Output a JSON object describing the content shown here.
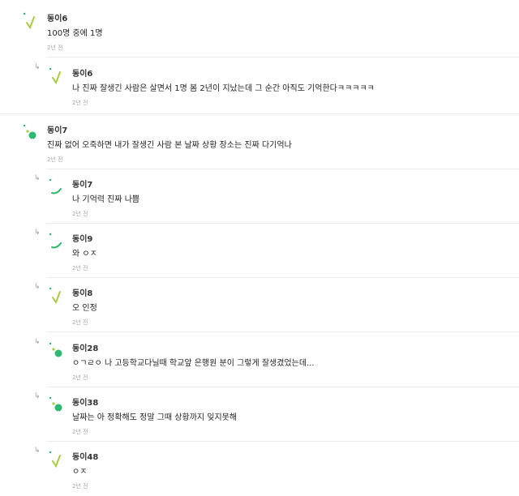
{
  "colors": {
    "accent_green": "#2eb872",
    "accent_lime": "#a5cf3a",
    "divider": "#ececec",
    "time_text": "#a8a8a8"
  },
  "comments": [
    {
      "nick": "동이6",
      "text": "100명 중에 1명",
      "time": "2년 전",
      "reply": false,
      "avatar_icon": "lime-slash-avatar-icon"
    },
    {
      "nick": "동이6",
      "text": "나 진짜 잘생긴 사람은 살면서 1명 봄 2년이 지났는데 그 순간 아직도 기억한다ㅋㅋㅋㅋㅋ",
      "time": "2년 전",
      "reply": true,
      "avatar_icon": "lime-slash-avatar-icon"
    },
    {
      "nick": "동이7",
      "text": "진짜 없어 오죽하면 내가 잘생긴 사람 본 날짜 상황 장소는 진짜 다기억나",
      "time": "2년 전",
      "reply": false,
      "avatar_icon": "green-dot-avatar-icon"
    },
    {
      "nick": "동이7",
      "text": "나 기억력 진짜 나쁨",
      "time": "2년 전",
      "reply": true,
      "avatar_icon": "green-arc-avatar-icon"
    },
    {
      "nick": "동이9",
      "text": "와 ㅇㅈ",
      "time": "2년 전",
      "reply": true,
      "avatar_icon": "green-arc-avatar-icon"
    },
    {
      "nick": "동이8",
      "text": "오 인정",
      "time": "2년 전",
      "reply": true,
      "avatar_icon": "lime-slash-avatar-icon"
    },
    {
      "nick": "동이28",
      "text": "ㅇㄱㄹㅇ 나 고등학교다닐때 학교앞 은행원 분이 그렇게 잘생겼었는데...",
      "time": "2년 전",
      "reply": true,
      "avatar_icon": "green-dot-avatar-icon"
    },
    {
      "nick": "동이38",
      "text": "날짜는 아 정확해도 정말 그때 상황까지 잊지못해",
      "time": "2년 전",
      "reply": true,
      "avatar_icon": "green-dot-avatar-icon"
    },
    {
      "nick": "동이48",
      "text": "ㅇㅈ",
      "time": "2년 전",
      "reply": true,
      "avatar_icon": "lime-slash-avatar-icon"
    }
  ],
  "reply_arrow_glyph": "↳"
}
